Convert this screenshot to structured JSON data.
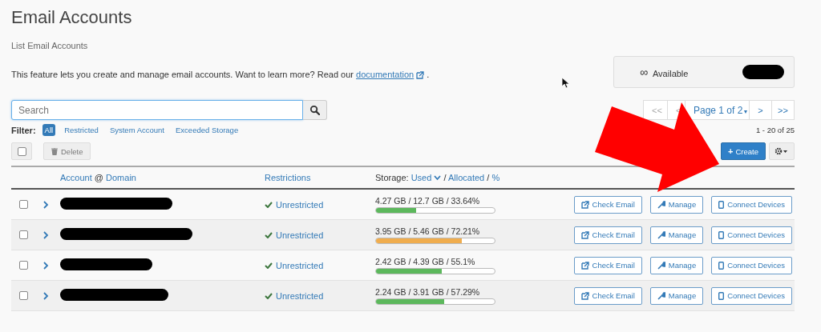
{
  "page": {
    "title": "Email Accounts",
    "subtitle": "List Email Accounts",
    "description": "This feature lets you create and manage email accounts. Want to learn more? Read our",
    "doc_link": "documentation",
    "doc_suffix": "."
  },
  "available": {
    "symbol": "∞",
    "label": "Available"
  },
  "search": {
    "placeholder": "Search"
  },
  "pagination": {
    "buttons": [
      "<<",
      "<"
    ],
    "page_label": "Page 1 of 2",
    "page_caret": "▼",
    "next_buttons": [
      ">",
      ">>"
    ],
    "range": "1 - 20 of 25"
  },
  "filter": {
    "label": "Filter:",
    "options": [
      {
        "label": "All",
        "selected": true
      },
      {
        "label": "Restricted",
        "selected": false
      },
      {
        "label": "System Account",
        "selected": false
      },
      {
        "label": "Exceeded Storage",
        "selected": false
      }
    ]
  },
  "toolbar": {
    "delete": "Delete",
    "create_symbol": "+",
    "create": "Create",
    "select_all_checked": false
  },
  "table": {
    "columns": {
      "account": "Account",
      "at": "@",
      "domain": "Domain",
      "restrictions": "Restrictions",
      "storage": "Storage:",
      "used": "Used",
      "slash_1": "/",
      "allocated": "Allocated",
      "slash_2": "/",
      "percent": "%"
    },
    "rows": [
      {
        "checked": false,
        "restriction": "Unrestricted",
        "storage": "4.27 GB / 12.7 GB / 33.64%",
        "level": 0.3364,
        "color": "#5cb85c",
        "actions": [
          "Check Email",
          "Manage",
          "Connect Devices"
        ]
      },
      {
        "checked": false,
        "restriction": "Unrestricted",
        "storage": "3.95 GB / 5.46 GB / 72.21%",
        "level": 0.7221,
        "color": "#f0ad4e",
        "actions": [
          "Check Email",
          "Manage",
          "Connect Devices"
        ]
      },
      {
        "checked": false,
        "restriction": "Unrestricted",
        "storage": "2.42 GB / 4.39 GB / 55.1%",
        "level": 0.551,
        "color": "#5cb85c",
        "actions": [
          "Check Email",
          "Manage",
          "Connect Devices"
        ]
      },
      {
        "checked": false,
        "restriction": "Unrestricted",
        "storage": "2.24 GB / 3.91 GB / 57.29%",
        "level": 0.5729,
        "color": "#5cb85c",
        "actions": [
          "Check Email",
          "Manage",
          "Connect Devices"
        ]
      }
    ]
  }
}
